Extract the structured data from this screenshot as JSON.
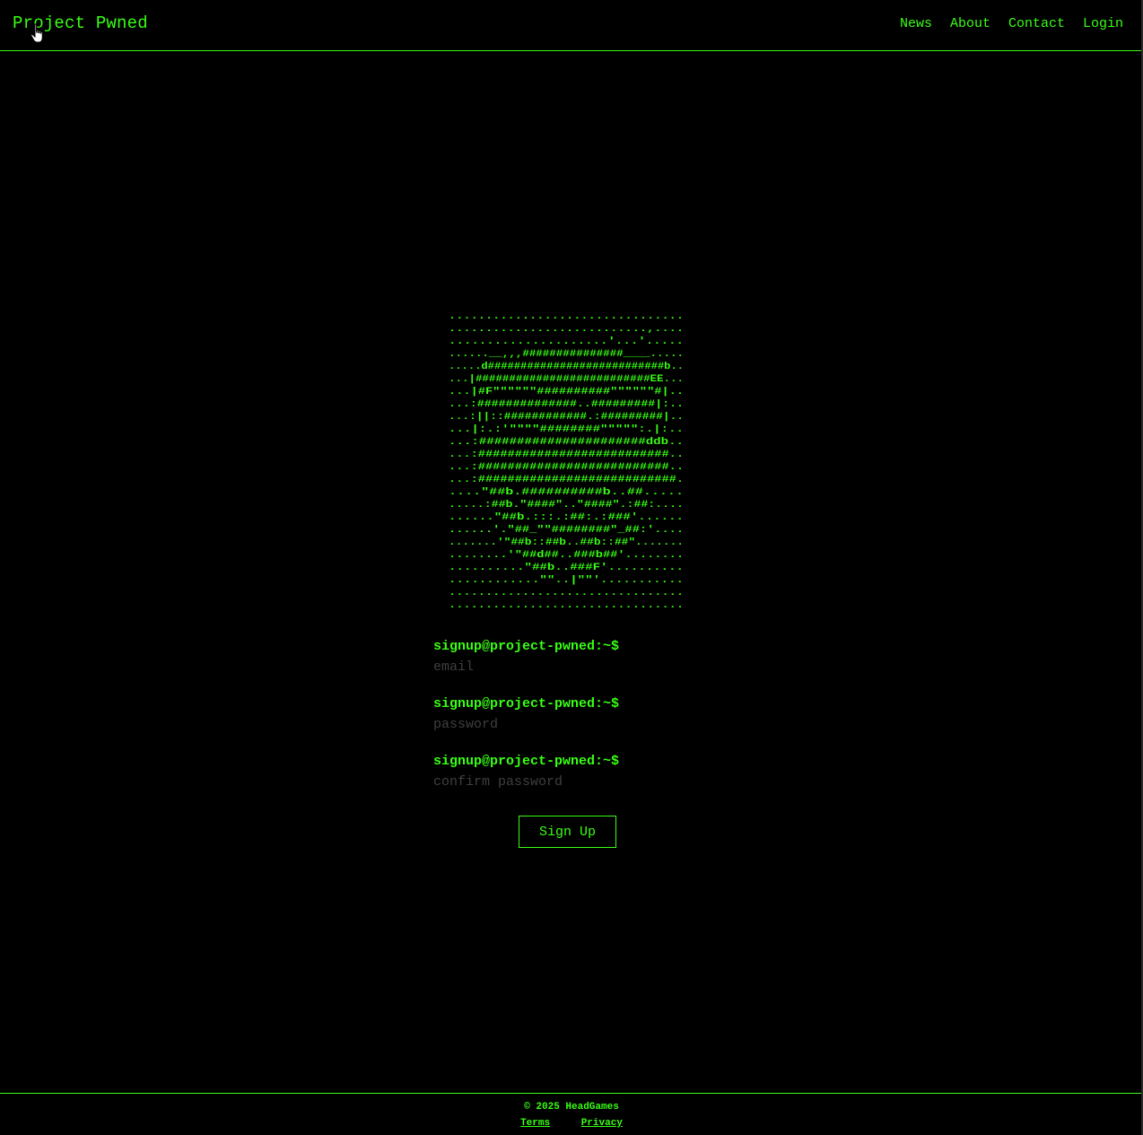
{
  "header": {
    "brand": "Project Pwned",
    "nav": [
      "News",
      "About",
      "Contact",
      "Login"
    ]
  },
  "ascii_art": {
    "description_icon": "hooded-figure-ascii-art",
    "rows": [
      "................................",
      "...........................,....",
      ".....................'...'.....",
      "......__,,,###############____.....",
      ".....d###########################b..",
      "...|##########################EE...",
      "...|#F\"\"\"\"\"\"##########\"\"\"\"\"\"#|..",
      "...:##############..#########|:..",
      "...:||::############.:#########|..",
      "...|:.:'\"\"\"\"########\"\"\"\"\":.|:..",
      "...:######################ddb..",
      "...:##########################..",
      "...:##########################..",
      "...:###########################.",
      "....\"##b.##########b..##.....",
      ".....:##b.\"####\"..\"####\".:##:....",
      "......\"##b.:::.:##:.:###'......",
      "......'.\"##_\"\"########\"_##:'....",
      ".......'\"##b::##b..##b::##\".......",
      "........'\"##d##..###b##'........",
      "..........\"##b..###F'..........",
      "............\"\"..|\"\"'...........",
      "................................",
      "................................"
    ]
  },
  "form": {
    "prompt": "signup@project-pwned:~$",
    "email_placeholder": "email",
    "password_placeholder": "password",
    "confirm_placeholder": "confirm password",
    "submit_label": "Sign Up"
  },
  "footer": {
    "copyright": "© 2025 HeadGames",
    "terms": "Terms",
    "privacy": "Privacy"
  },
  "colors": {
    "accent": "#39ff14",
    "background": "#000000",
    "placeholder": "#3f3f3f"
  }
}
